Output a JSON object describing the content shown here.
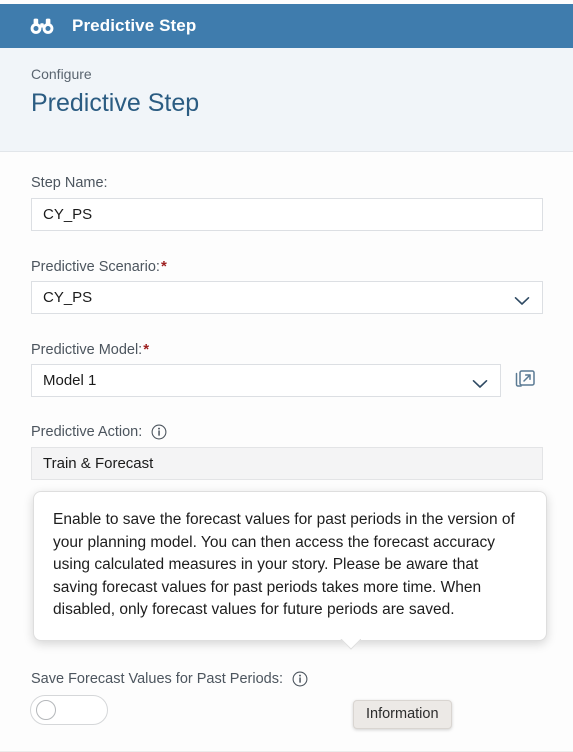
{
  "window": {
    "icon": "binoculars-icon",
    "title": "Predictive Step"
  },
  "subheader": {
    "breadcrumb": "Configure",
    "page_title": "Predictive Step"
  },
  "form": {
    "step_name": {
      "label": "Step Name:",
      "value": "CY_PS",
      "required": false
    },
    "predictive_scenario": {
      "label": "Predictive Scenario:",
      "required_marker": "*",
      "value": "CY_PS",
      "icon": "chevron-down-icon"
    },
    "predictive_model": {
      "label": "Predictive Model:",
      "required_marker": "*",
      "value": "Model 1",
      "icon": "chevron-down-icon",
      "action_icon": "open-in-new-window-icon"
    },
    "predictive_action": {
      "label": "Predictive Action:",
      "info_icon": "information-icon",
      "value": "Train & Forecast",
      "readonly": true
    },
    "save_forecast": {
      "label": "Save Forecast Values for Past Periods:",
      "info_icon": "information-icon",
      "toggle_state": "off"
    }
  },
  "popover": {
    "text": "Enable to save the forecast values for past periods in the version of your planning model. You can then access the forecast accuracy using calculated measures in your story. Please be aware that saving forecast values for past periods takes more time. When disabled, only forecast values for future periods are saved."
  },
  "mini_tooltip": {
    "text": "Information"
  },
  "colors": {
    "header_blue": "#3f7cad",
    "subheader_bg": "#f1f5f9",
    "title_blue": "#2b5c82",
    "required_red": "#9d1f1f",
    "label_grey": "#4c555e"
  }
}
